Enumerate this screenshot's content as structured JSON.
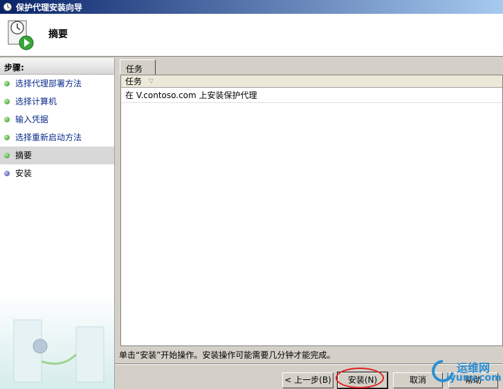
{
  "window": {
    "title": "保护代理安装向导"
  },
  "header": {
    "title": "摘要"
  },
  "sidebar": {
    "heading": "步骤:",
    "items": [
      {
        "label": "选择代理部署方法",
        "state": "done"
      },
      {
        "label": "选择计算机",
        "state": "done"
      },
      {
        "label": "输入凭据",
        "state": "done"
      },
      {
        "label": "选择重新启动方法",
        "state": "done"
      },
      {
        "label": "摘要",
        "state": "active"
      },
      {
        "label": "安装",
        "state": "todo"
      }
    ]
  },
  "main": {
    "tab_label": "任务",
    "column_header": "任务",
    "rows": [
      "在 V.contoso.com 上安装保护代理"
    ]
  },
  "status_text": "单击“安装”开始操作。安装操作可能需要几分钟才能完成。",
  "buttons": {
    "back": "< 上一步(B)",
    "install": "安装(N)",
    "cancel": "取消",
    "help": "帮助"
  },
  "watermark": {
    "top": "运维网",
    "bottom": "iyunv.com"
  },
  "colors": {
    "titlebar_start": "#0a246a",
    "titlebar_end": "#a6caf0",
    "link": "#0a2a8a",
    "annotation": "#e02020"
  }
}
